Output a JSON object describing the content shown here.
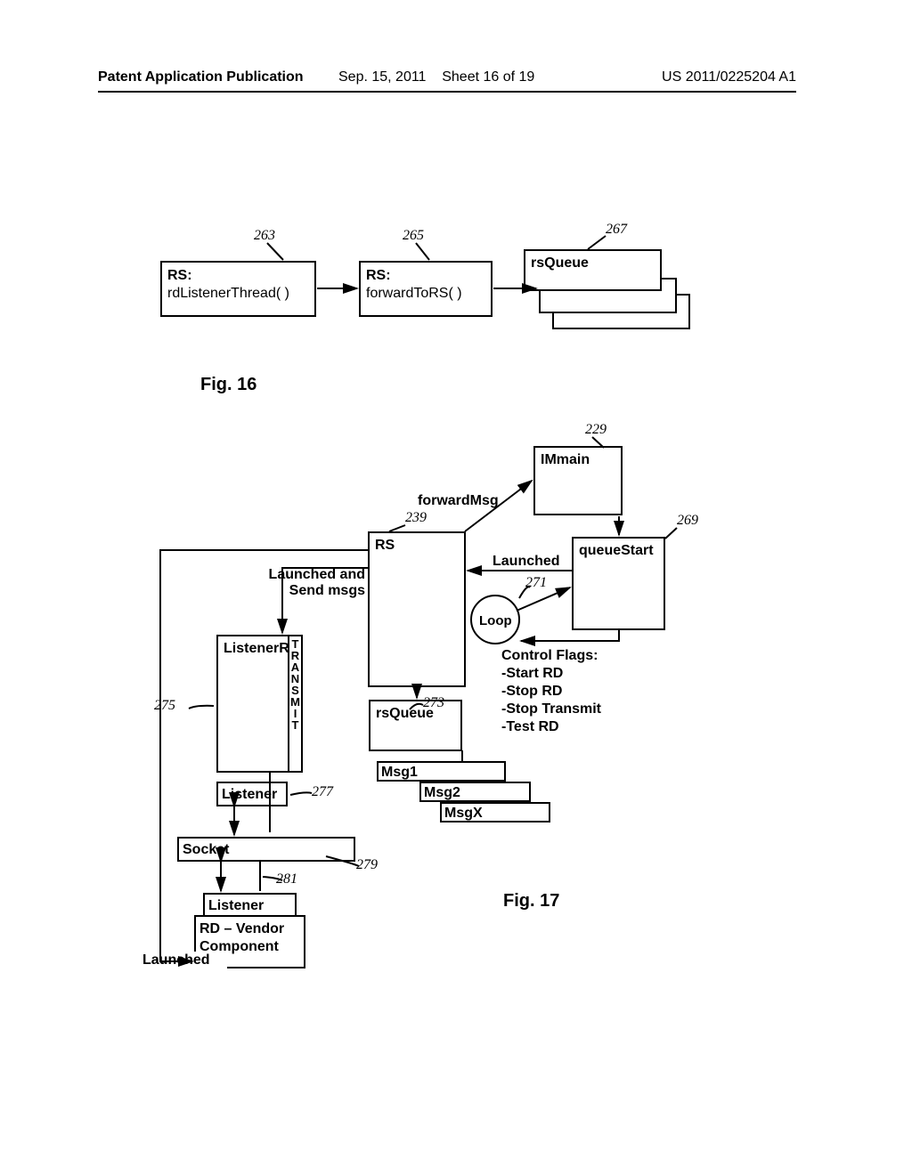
{
  "header": {
    "left": "Patent Application Publication",
    "date": "Sep. 15, 2011",
    "sheet": "Sheet 16 of 19",
    "pubno": "US 2011/0225204 A1"
  },
  "fig16": {
    "caption": "Fig. 16",
    "ref263": "263",
    "ref265": "265",
    "ref267": "267",
    "box1_l1": "RS:",
    "box1_l2": "rdListenerThread( )",
    "box2_l1": "RS:",
    "box2_l2": "forwardToRS( )",
    "box3": "rsQueue"
  },
  "fig17": {
    "caption": "Fig. 17",
    "ref229": "229",
    "ref239": "239",
    "ref269": "269",
    "ref271": "271",
    "ref273": "273",
    "ref275": "275",
    "ref277": "277",
    "ref279": "279",
    "ref281": "281",
    "immain": "IMmain",
    "forwardMsg": "forwardMsg",
    "rs": "RS",
    "launched": "Launched",
    "launchedSend_l1": "Launched and",
    "launchedSend_l2": "Send msgs",
    "queueStart": "queueStart",
    "loop": "Loop",
    "rsQueue": "rsQueue",
    "msg1": "Msg1",
    "msg2": "Msg2",
    "msgx": "MsgX",
    "listenerRS": "ListenerRS",
    "transmit": "TRANSMIT",
    "listener1": "Listener",
    "socket": "Socket",
    "listener2": "Listener",
    "rd_l1": "RD – Vendor",
    "rd_l2": "Component",
    "launched2": "Launched",
    "ctrl_title": "Control Flags:",
    "ctrl_1": "-Start RD",
    "ctrl_2": "-Stop RD",
    "ctrl_3": "-Stop Transmit",
    "ctrl_4": "-Test RD"
  }
}
